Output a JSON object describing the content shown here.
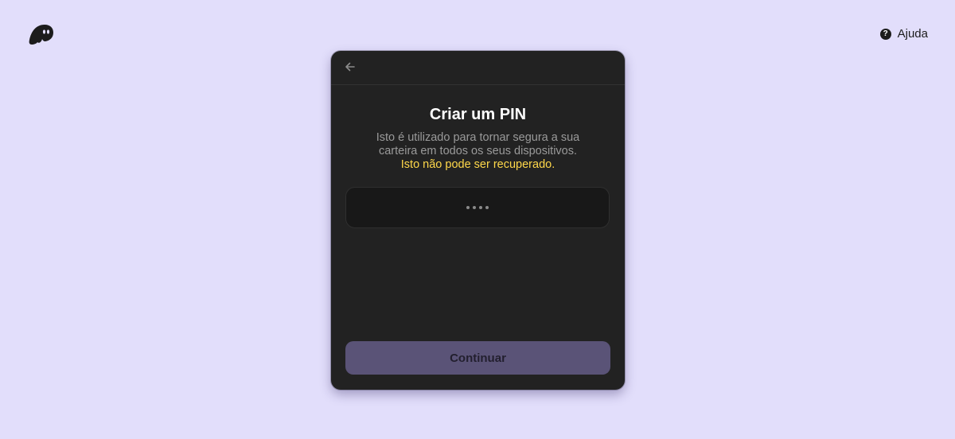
{
  "header": {
    "help_label": "Ajuda",
    "logo_icon": "ghost-logo-icon",
    "help_icon": "question-circle-icon"
  },
  "card": {
    "back_icon": "arrow-left-icon",
    "title": "Criar um PIN",
    "description": "Isto é utilizado para tornar segura a sua carteira em todos os seus dispositivos.",
    "warning": "Isto não pode ser recuperado.",
    "pin": {
      "length_entered": 4,
      "dot_color": "#8a8a8a"
    },
    "continue_label": "Continuar"
  },
  "colors": {
    "page_background": "#e2defb",
    "card_background": "#222222",
    "warning": "#ffd84a",
    "button_disabled": "#5a5377"
  }
}
